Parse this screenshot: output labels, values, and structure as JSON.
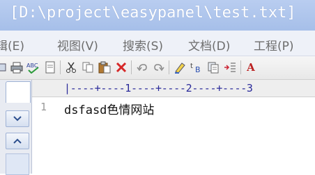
{
  "window": {
    "title": "[D:\\project\\easypanel\\test.txt]"
  },
  "menu": {
    "items": [
      {
        "label": "辑(E)"
      },
      {
        "label": "视图(V)"
      },
      {
        "label": "搜索(S)"
      },
      {
        "label": "文档(D)"
      },
      {
        "label": "工程(P)"
      }
    ]
  },
  "toolbar": {
    "icons": [
      "print-preview-icon",
      "print-icon",
      "spellcheck-icon",
      "page-icon",
      "cut-icon",
      "copy-icon",
      "paste-icon",
      "delete-icon",
      "undo-icon",
      "redo-icon",
      "marker-icon",
      "case-icon",
      "duplicate-icon",
      "indent-icon",
      "font-icon"
    ],
    "font_button_label": "A"
  },
  "ruler": {
    "text": "|----+----1----+----2----+----3"
  },
  "editor": {
    "lines": [
      {
        "number": "1",
        "text": "dsfasd色情网站"
      }
    ]
  },
  "colors": {
    "title_bg": "#a6bfe9",
    "ruler_text": "#2a2a9a",
    "delete_red": "#d62828"
  }
}
